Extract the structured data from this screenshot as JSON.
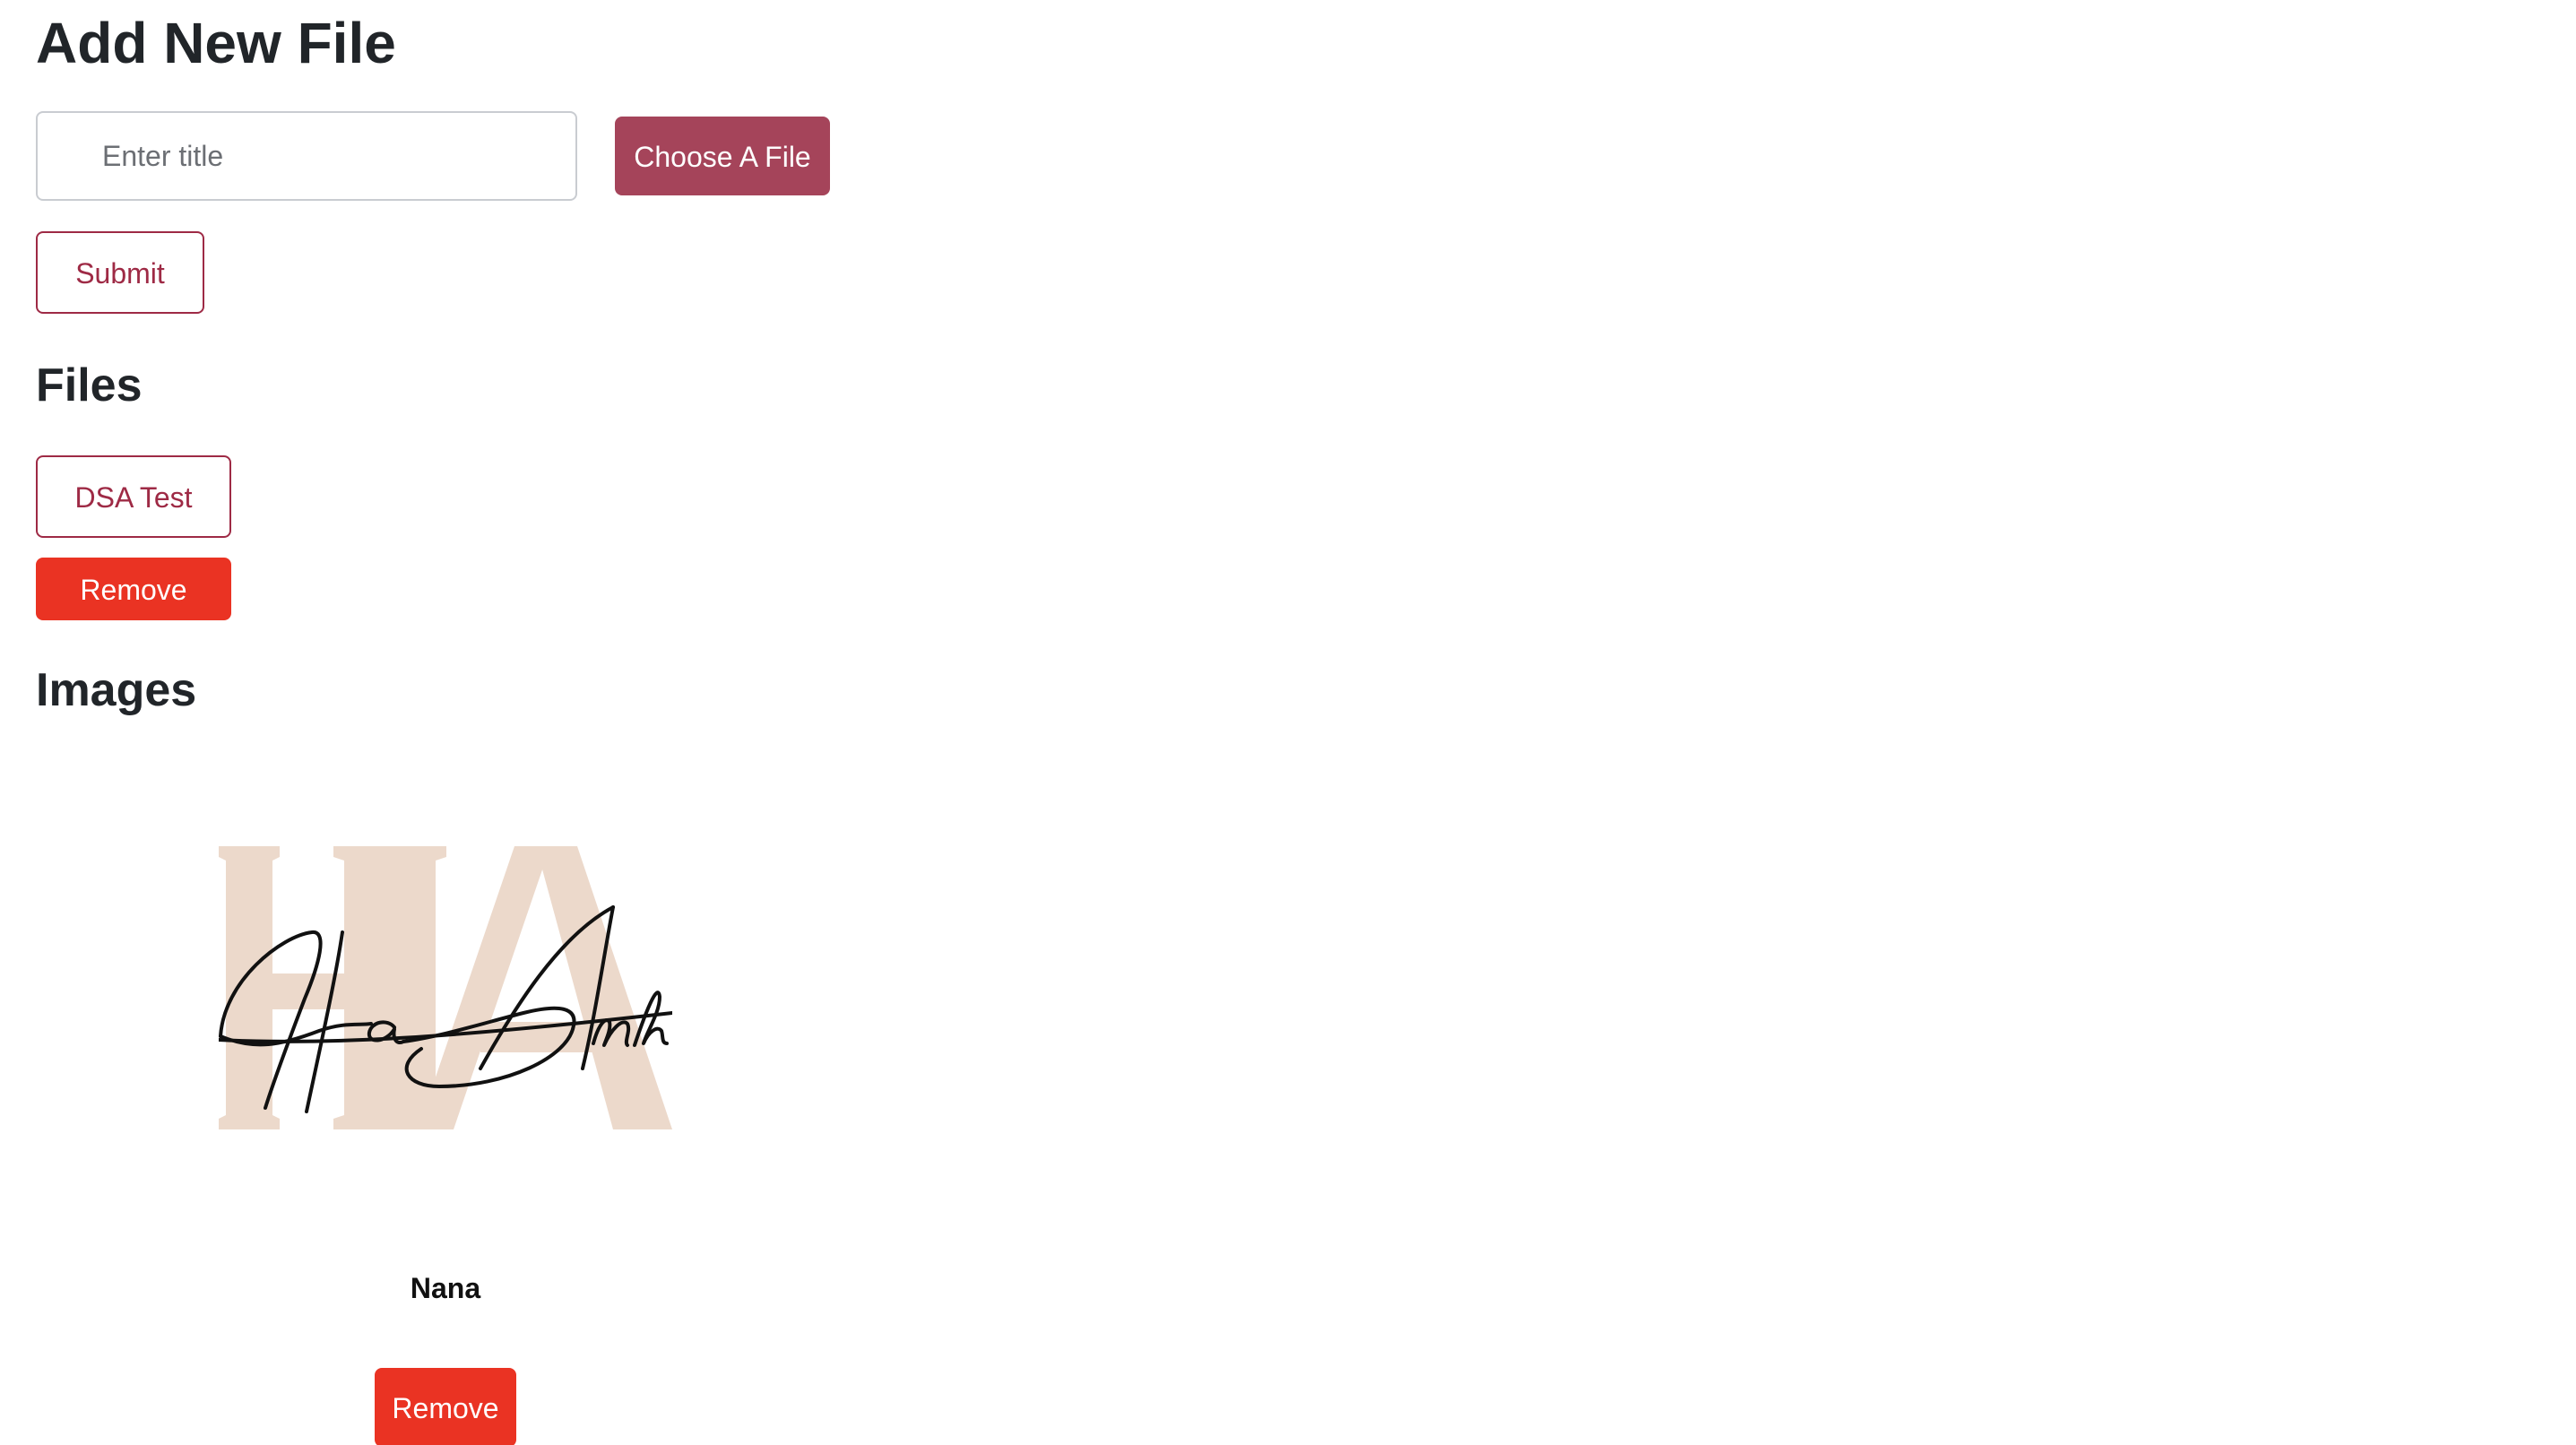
{
  "add_section": {
    "heading": "Add New File",
    "title_input": {
      "placeholder": "Enter title",
      "value": ""
    },
    "choose_file_label": "Choose A File",
    "submit_label": "Submit"
  },
  "files_section": {
    "heading": "Files",
    "items": [
      {
        "title": "DSA Test",
        "remove_label": "Remove"
      }
    ]
  },
  "images_section": {
    "heading": "Images",
    "items": [
      {
        "logo_letters": "HA",
        "signature": "Ha Anh",
        "title": "Nana",
        "remove_label": "Remove"
      }
    ]
  },
  "colors": {
    "heading": "#212529",
    "primary_outline": "#9e2a45",
    "choose_button_bg": "#a5445a",
    "danger": "#ea3323",
    "logo_letter_fill": "#ecd9cb",
    "signature_ink": "#111111"
  }
}
